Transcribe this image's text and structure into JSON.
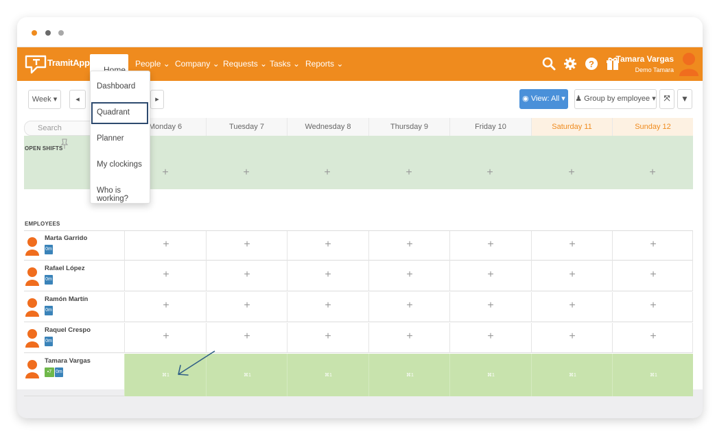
{
  "colors": {
    "accent": "#ef8b1e",
    "primary_button": "#4a90d9",
    "open_shifts_bg": "#d9e9d6",
    "selected_row_bg": "#c8e3ad",
    "badge_blue": "#3a83b9",
    "badge_green": "#6fb84a"
  },
  "navbar": {
    "logo_text": "TramitApp",
    "menu": [
      {
        "label": "Home",
        "icon": "chevron-down-icon"
      },
      {
        "label": "People",
        "icon": "chevron-down-icon"
      },
      {
        "label": "Company",
        "icon": "chevron-down-icon"
      },
      {
        "label": "Requests",
        "icon": "chevron-down-icon"
      },
      {
        "label": "Tasks",
        "icon": "chevron-down-icon"
      },
      {
        "label": "Reports",
        "icon": "chevron-down-icon"
      }
    ],
    "icons": [
      "search-icon",
      "gear-icon",
      "help-icon",
      "gift-icon"
    ],
    "user": {
      "name": "Tamara Vargas",
      "company": "Demo Tamara",
      "avatar": "user-avatar-icon"
    }
  },
  "home_menu": {
    "items": [
      "Dashboard",
      "Quadrant",
      "Planner",
      "My clockings",
      "Who is working?"
    ],
    "highlighted": "Quadrant"
  },
  "toolbar": {
    "period": "Week",
    "view_label": "View: All",
    "group_label": "Group by employee",
    "icons": [
      "chevron-left-icon",
      "chevron-right-icon",
      "eye-icon",
      "users-icon",
      "expand-icon",
      "filter-icon"
    ]
  },
  "grid": {
    "search_placeholder": "Search",
    "days": [
      {
        "label": "Monday 6",
        "weekend": false
      },
      {
        "label": "Tuesday 7",
        "weekend": false
      },
      {
        "label": "Wednesday 8",
        "weekend": false
      },
      {
        "label": "Thursday 9",
        "weekend": false
      },
      {
        "label": "Friday 10",
        "weekend": false
      },
      {
        "label": "Saturday 11",
        "weekend": true
      },
      {
        "label": "Sunday 12",
        "weekend": true
      }
    ],
    "open_shifts_label": "OPEN SHIFTS",
    "employees_label": "EMPLOYEES",
    "add_symbol": "+",
    "employees": [
      {
        "name": "Marta Garrido",
        "badges": [
          "0m"
        ],
        "selected": false
      },
      {
        "name": "Rafael López",
        "badges": [
          "0m"
        ],
        "selected": false
      },
      {
        "name": "Ramón Martín",
        "badges": [
          "0m"
        ],
        "selected": false
      },
      {
        "name": "Raquel Crespo",
        "badges": [
          "0m"
        ],
        "selected": false
      },
      {
        "name": "Tamara Vargas",
        "badges": [
          "7",
          "0m"
        ],
        "selected": true,
        "day_marks": [
          "1",
          "1",
          "1",
          "1",
          "1",
          "1",
          "1"
        ]
      }
    ]
  }
}
